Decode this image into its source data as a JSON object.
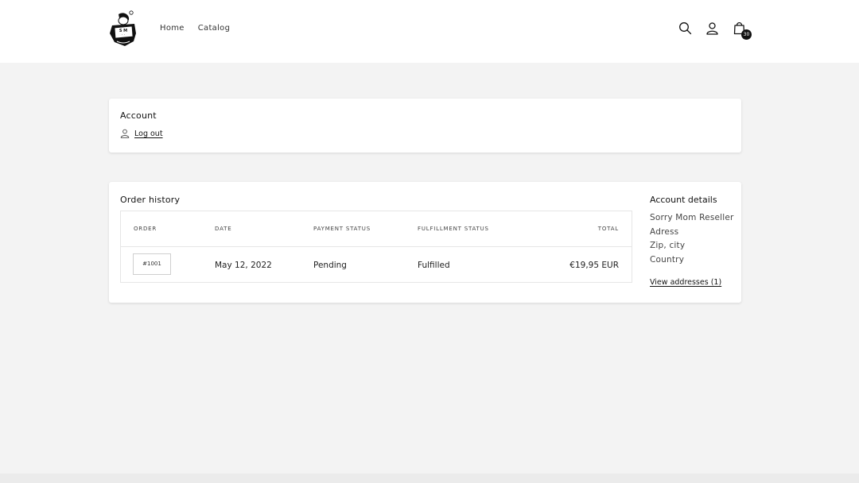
{
  "header": {
    "logo_icon": "brand-logo-icon",
    "nav": [
      {
        "label": "Home"
      },
      {
        "label": "Catalog"
      }
    ],
    "icons": [
      "search-icon",
      "account-icon",
      "cart-icon"
    ],
    "cart_count": "30"
  },
  "account": {
    "title": "Account",
    "logout_label": "Log out"
  },
  "orders": {
    "title": "Order history",
    "columns": {
      "order": "ORDER",
      "date": "DATE",
      "payment": "PAYMENT STATUS",
      "fulfillment": "FULFILLMENT STATUS",
      "total": "TOTAL"
    },
    "rows": [
      {
        "order": "#1001",
        "date": "May 12, 2022",
        "payment": "Pending",
        "fulfillment": "Fulfilled",
        "total": "€19,95 EUR"
      }
    ]
  },
  "details": {
    "title": "Account details",
    "lines": [
      "Sorry Mom Reseller",
      "Adress",
      "Zip, city",
      "Country"
    ],
    "addresses_link": "View addresses (1)"
  }
}
